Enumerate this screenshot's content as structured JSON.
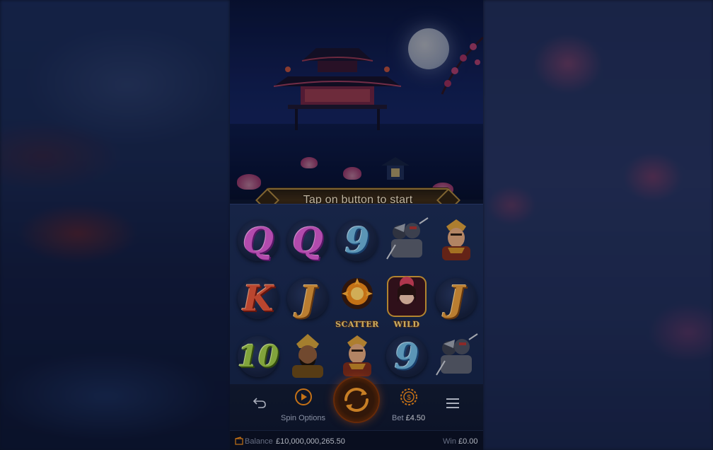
{
  "banner": {
    "text": "Tap on button to start"
  },
  "reels": {
    "rows": [
      [
        {
          "type": "letter",
          "glyph": "Q",
          "style": "q"
        },
        {
          "type": "letter",
          "glyph": "Q",
          "style": "q"
        },
        {
          "type": "letter",
          "glyph": "9",
          "style": "nine"
        },
        {
          "type": "portrait",
          "icon": "soldiers-icon"
        },
        {
          "type": "portrait",
          "icon": "warrior-hero-icon"
        }
      ],
      [
        {
          "type": "letter",
          "glyph": "K",
          "style": "k"
        },
        {
          "type": "letter",
          "glyph": "J",
          "style": "j"
        },
        {
          "type": "special",
          "icon": "scatter-icon",
          "label": "SCATTER"
        },
        {
          "type": "special",
          "icon": "wild-icon",
          "label": "WILD"
        },
        {
          "type": "letter",
          "glyph": "J",
          "style": "j"
        }
      ],
      [
        {
          "type": "letter",
          "glyph": "10",
          "style": "ten"
        },
        {
          "type": "portrait",
          "icon": "general-icon"
        },
        {
          "type": "portrait",
          "icon": "warrior-hero-icon"
        },
        {
          "type": "letter",
          "glyph": "9",
          "style": "nine"
        },
        {
          "type": "portrait",
          "icon": "soldiers-icon"
        }
      ]
    ]
  },
  "controls": {
    "back_icon": "back-arrow-icon",
    "spin_options_label": "Spin Options",
    "spin_icon": "spin-icon",
    "bet_label": "Bet",
    "bet_value": "£4.50",
    "menu_icon": "menu-icon"
  },
  "status": {
    "balance_label": "Balance",
    "balance_value": "£10,000,000,265.50",
    "win_label": "Win",
    "win_value": "£0.00"
  },
  "colors": {
    "accent": "#f08a1c",
    "gold": "#d9a13a"
  }
}
